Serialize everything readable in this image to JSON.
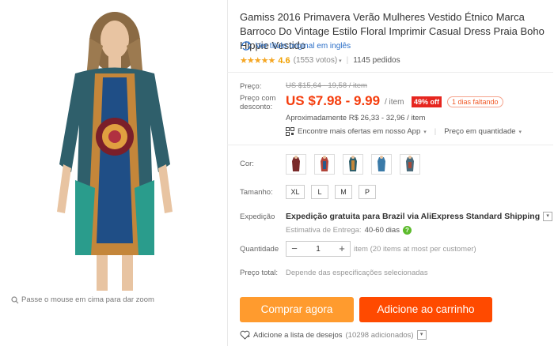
{
  "gallery": {
    "zoom_hint": "Passe o mouse em cima para dar zoom"
  },
  "product": {
    "title": "Gamiss 2016 Primavera Verão Mulheres Vestido Étnico Marca Barroco Do Vintage Estilo Floral Imprimir Casual Dress Praia Boho Hippie Vestido",
    "view_original": "Ver título original em inglês",
    "stars": "★★★★★",
    "rating": "4.6",
    "votes": "(1553 votos)",
    "orders": "1145 pedidos"
  },
  "price": {
    "label": "Preço:",
    "old_range": "US $15,64 - 19,58 / item",
    "discount_label_1": "Preço com",
    "discount_label_2": "desconto:",
    "new_range": "US $7.98 - 9.99",
    "per_item": "/ item",
    "off_badge": "49% off",
    "days_left": "1 dias faltando",
    "approx": "Aproximadamente R$ 26,33 - 32,96 / item",
    "more_offers": "Encontre mais ofertas em nosso App",
    "qty_price": "Preço em quantidade"
  },
  "options": {
    "color_label": "Cor:",
    "colors": [
      "burgundy",
      "red-print",
      "teal-print",
      "blue",
      "multicolor"
    ],
    "size_label": "Tamanho:",
    "sizes": [
      "XL",
      "L",
      "M",
      "P"
    ]
  },
  "shipping": {
    "label": "Expedição",
    "method_prefix": "Expedição gratuita para Brazil via AliExpress Standard Shipping",
    "delivery_label": "Estimativa de Entrega:",
    "delivery_days": "40-60 dias"
  },
  "quantity": {
    "label": "Quantidade",
    "minus": "−",
    "value": "1",
    "plus": "+",
    "note": "item (20 items at most per customer)"
  },
  "total": {
    "label": "Preço total:",
    "note": "Depende das especificações selecionadas"
  },
  "actions": {
    "buy_now": "Comprar agora",
    "add_to_cart": "Adicione ao carrinho",
    "wishlist": "Adicione a lista de desejos",
    "wishlist_count": "(10298 adicionados)"
  },
  "colors": {
    "price_red": "#f53d0d",
    "buy_orange": "#ff9b2e",
    "cart_orange": "#ff4a00",
    "link_blue": "#2a6ec7",
    "star_gold": "#f5a623"
  }
}
